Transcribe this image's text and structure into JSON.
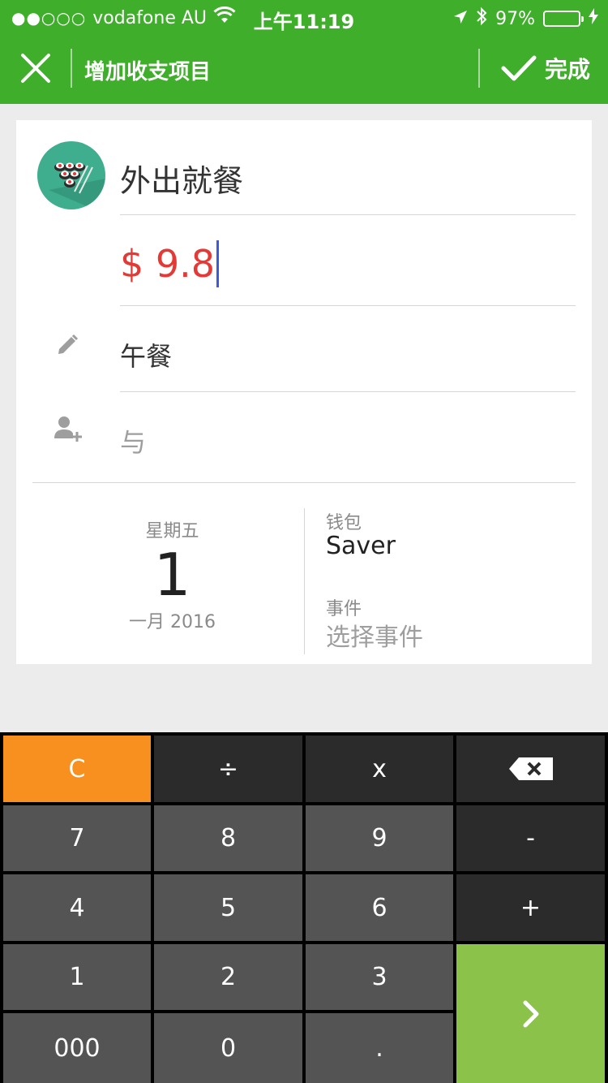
{
  "status_bar": {
    "signal_dots": "●●○○○",
    "carrier": "vodafone AU",
    "time": "上午11:19",
    "battery_percent": "97%",
    "battery_level": 0.97
  },
  "header": {
    "title": "增加收支项目",
    "done_label": "完成"
  },
  "form": {
    "category_name": "外出就餐",
    "amount": "$ 9.8",
    "note": "午餐",
    "with_placeholder": "与",
    "date": {
      "weekday": "星期五",
      "day": "1",
      "month_year": "一月 2016"
    },
    "wallet_label": "钱包",
    "wallet_value": "Saver",
    "event_label": "事件",
    "event_placeholder": "选择事件"
  },
  "keypad": {
    "clear": "C",
    "divide": "÷",
    "multiply": "x",
    "minus": "-",
    "plus": "+",
    "digits": [
      "7",
      "8",
      "9",
      "4",
      "5",
      "6",
      "1",
      "2",
      "3"
    ],
    "triple_zero": "000",
    "zero": "0",
    "decimal": ".",
    "next": "›"
  },
  "colors": {
    "header_green": "#3fae2a",
    "amount_red": "#e53935",
    "clear_orange": "#f7901e",
    "next_green": "#8bc34a"
  }
}
